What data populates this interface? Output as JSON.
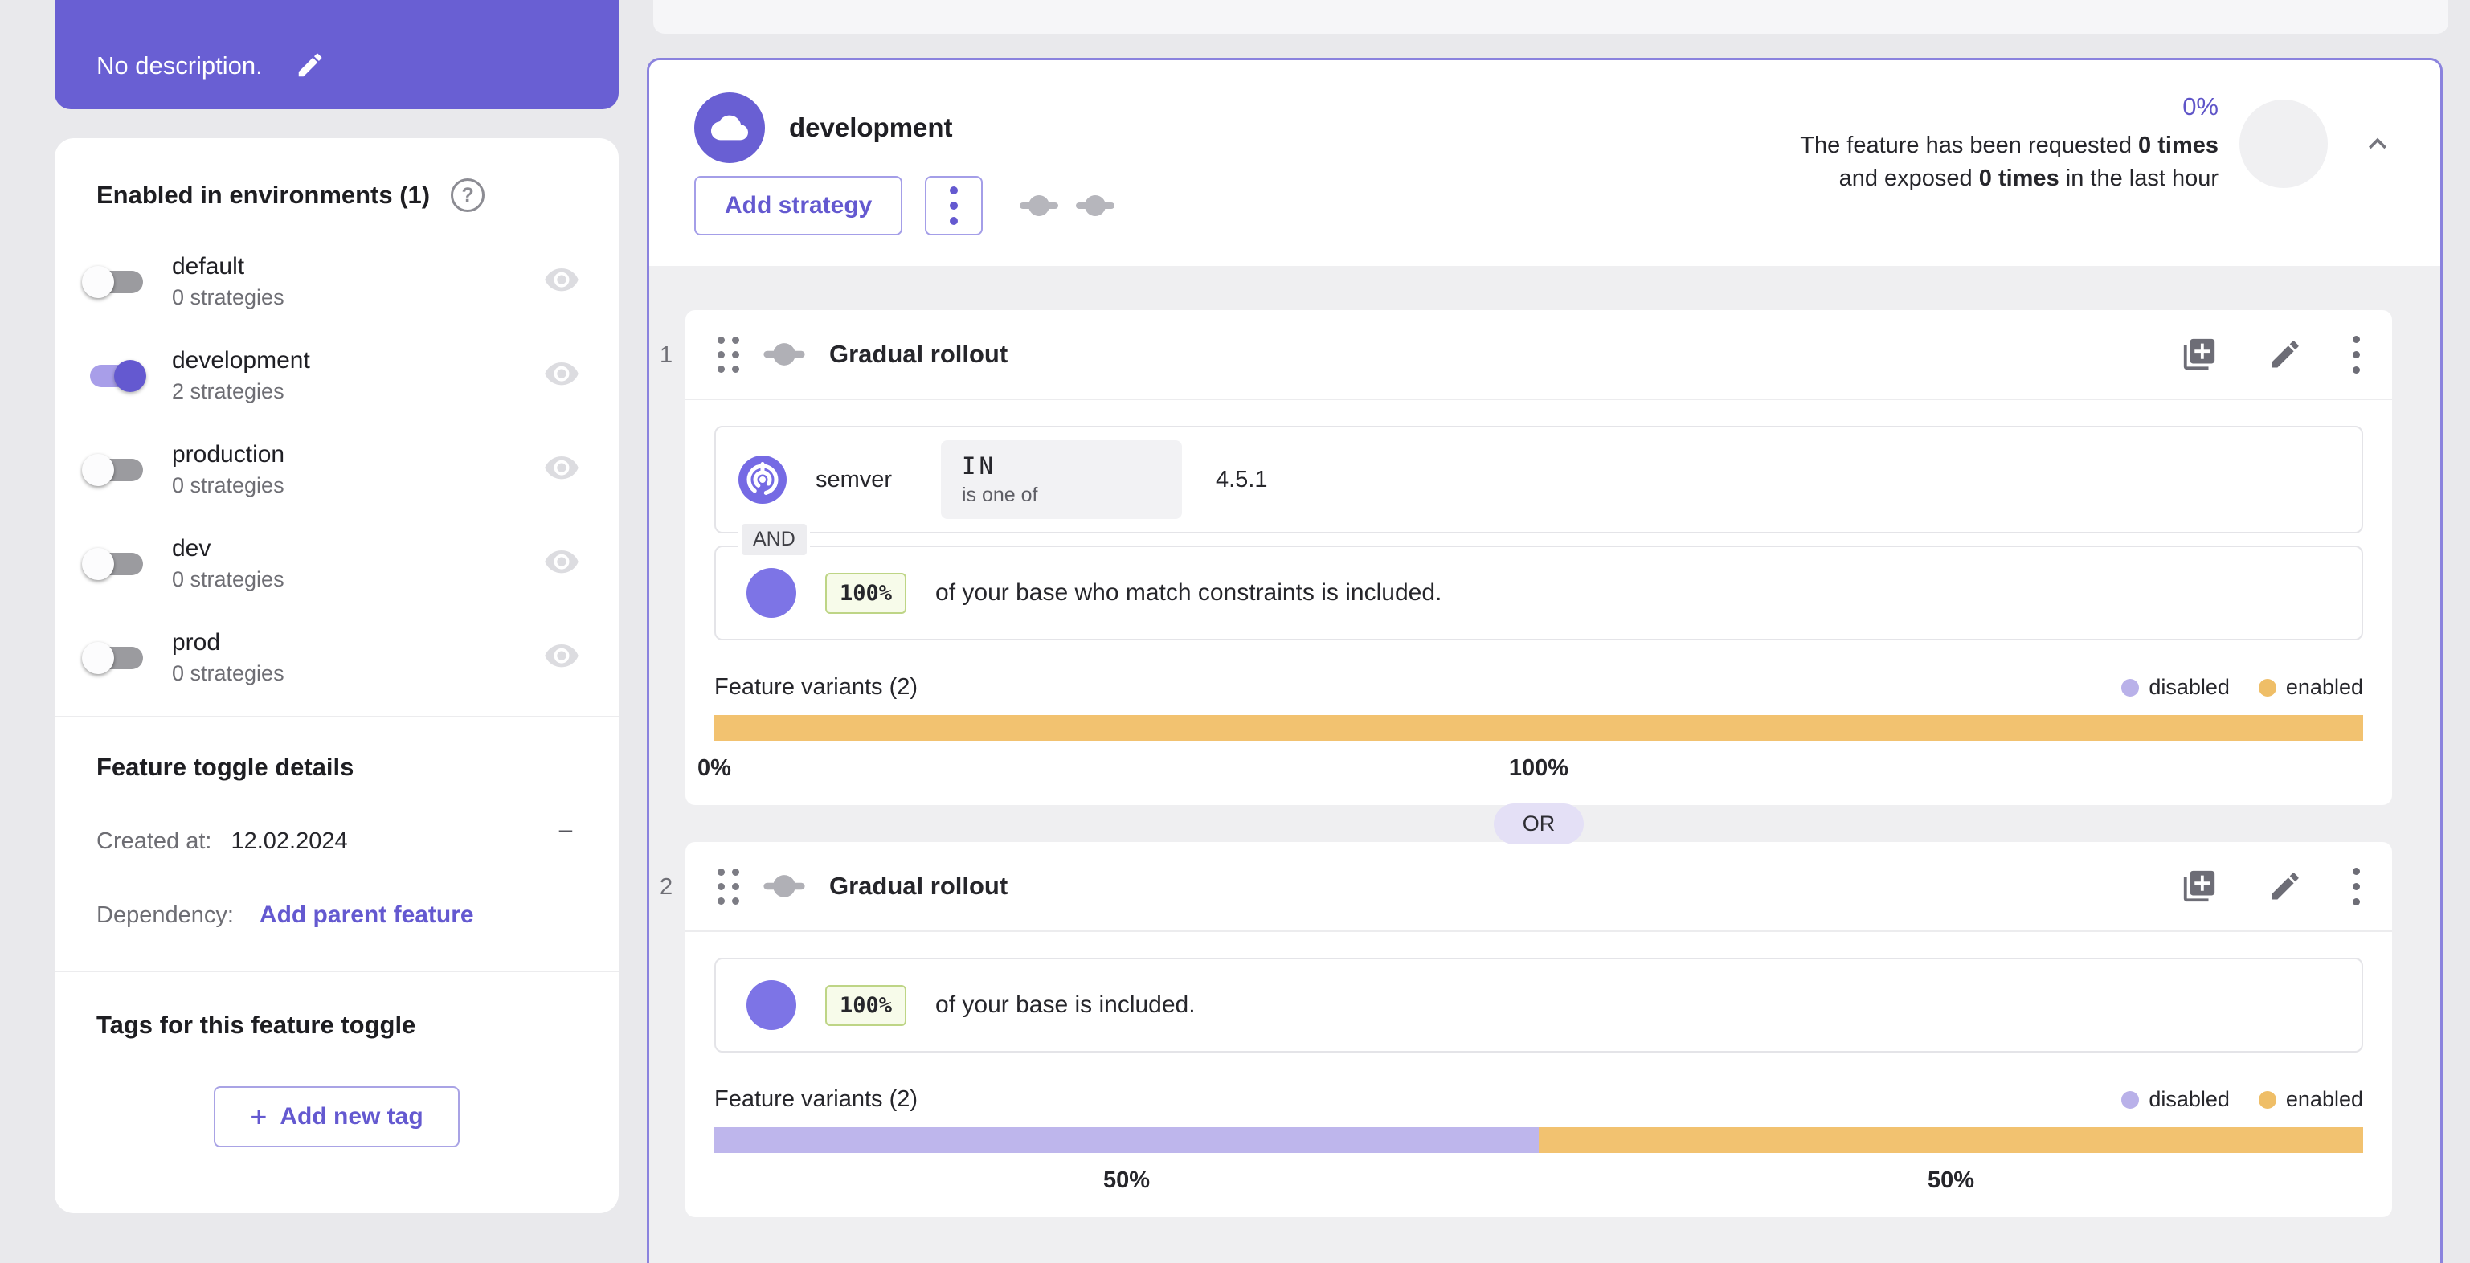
{
  "colors": {
    "purple": "#695fd3",
    "purple_text": "#6459d0",
    "card_border": "#8b83de",
    "page_bg": "#e9e9ec",
    "body_bg": "#efeff1",
    "variant_disabled": "#beb6ec",
    "variant_enabled": "#f2c270",
    "chip_green_bg": "#f7fbea",
    "chip_green_border": "#bed586"
  },
  "sidebar": {
    "description": {
      "text": "No description."
    },
    "environments": {
      "title": "Enabled in environments (1)",
      "items": [
        {
          "name": "default",
          "strategies": "0 strategies",
          "enabled": false
        },
        {
          "name": "development",
          "strategies": "2 strategies",
          "enabled": true
        },
        {
          "name": "production",
          "strategies": "0 strategies",
          "enabled": false
        },
        {
          "name": "dev",
          "strategies": "0 strategies",
          "enabled": false
        },
        {
          "name": "prod",
          "strategies": "0 strategies",
          "enabled": false
        }
      ]
    },
    "details": {
      "title": "Feature toggle details",
      "created_label": "Created at:",
      "created_value": "12.02.2024",
      "collapse_glyph": "−",
      "dependency_label": "Dependency:",
      "dependency_action": "Add parent feature"
    },
    "tags": {
      "title": "Tags for this feature toggle",
      "plus_glyph": "+",
      "add_button_label": "Add new tag"
    }
  },
  "main": {
    "environment": {
      "name": "development",
      "add_strategy_label": "Add strategy",
      "exposure_percent": "0%",
      "metrics_line1_prefix": "The feature has been requested ",
      "metrics_line1_bold": "0 times",
      "metrics_line2_prefix": "and exposed ",
      "metrics_line2_bold": "0 times",
      "metrics_line2_suffix": " in the last hour"
    },
    "separator": "OR",
    "strategies": [
      {
        "index": "1",
        "title": "Gradual rollout",
        "constraint": {
          "context": "semver",
          "operator": "IN",
          "operator_caption": "is one of",
          "value": "4.5.1"
        },
        "connector": "AND",
        "rollout_percent": "100%",
        "rollout_text": "of your base who match constraints is included.",
        "variants_label": "Feature variants (2)",
        "legend": [
          {
            "label": "disabled"
          },
          {
            "label": "enabled"
          }
        ],
        "bar": {
          "disabled_pct": 0,
          "enabled_pct": 100,
          "labels": [
            {
              "text": "0%",
              "pos": 0
            },
            {
              "text": "100%",
              "pos": 50
            }
          ]
        }
      },
      {
        "index": "2",
        "title": "Gradual rollout",
        "rollout_percent": "100%",
        "rollout_text": "of your base is included.",
        "variants_label": "Feature variants (2)",
        "legend": [
          {
            "label": "disabled"
          },
          {
            "label": "enabled"
          }
        ],
        "bar": {
          "disabled_pct": 50,
          "enabled_pct": 50,
          "labels": [
            {
              "text": "50%",
              "pos": 25
            },
            {
              "text": "50%",
              "pos": 75
            }
          ]
        }
      }
    ]
  },
  "chart_data": [
    {
      "type": "bar",
      "title": "Strategy 1 feature variants split",
      "categories": [
        "disabled",
        "enabled"
      ],
      "values": [
        0,
        100
      ]
    },
    {
      "type": "bar",
      "title": "Strategy 2 feature variants split",
      "categories": [
        "disabled",
        "enabled"
      ],
      "values": [
        50,
        50
      ]
    }
  ]
}
